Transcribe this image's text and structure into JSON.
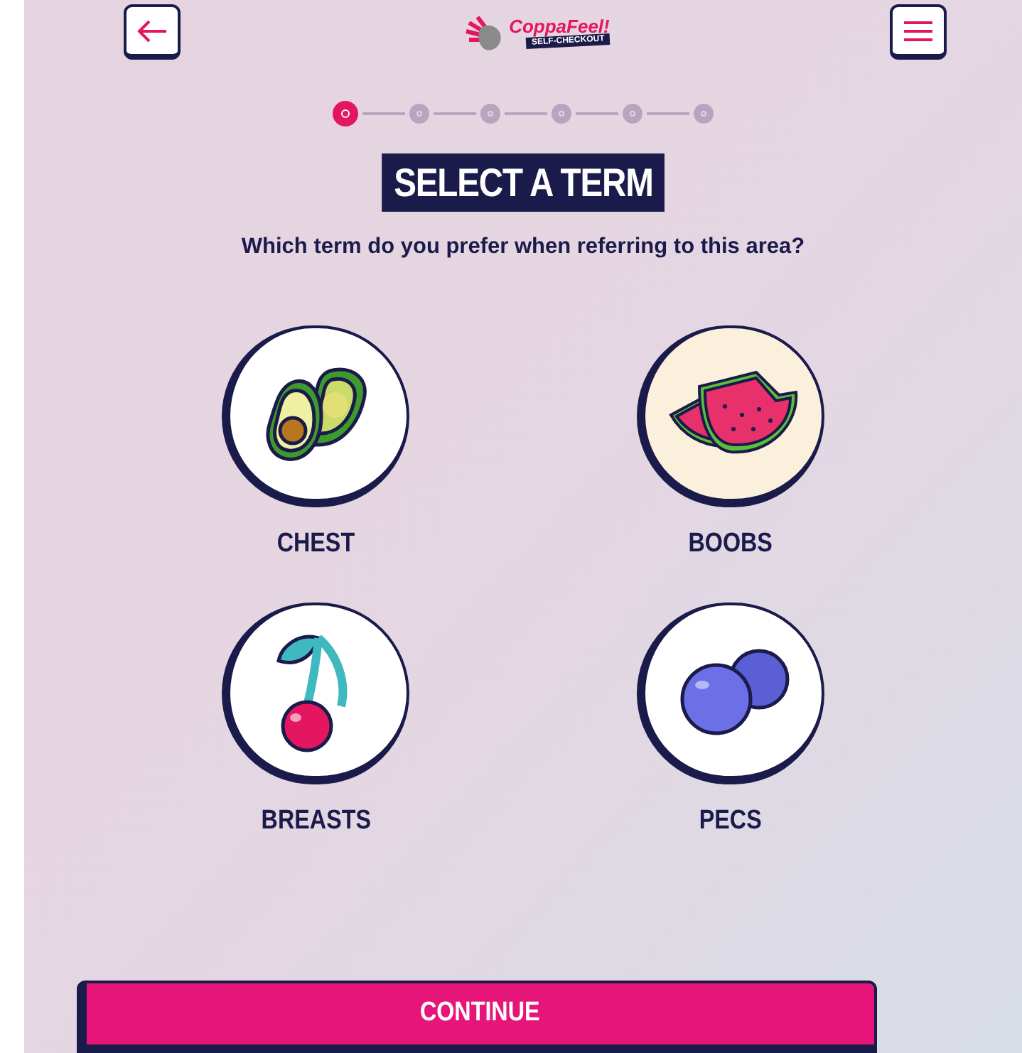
{
  "header": {
    "logo": {
      "title": "CoppaFeel!",
      "subtitle": "SELF-CHECKOUT"
    }
  },
  "steps": [
    {
      "selected": true
    },
    {
      "selected": false
    },
    {
      "selected": false
    },
    {
      "selected": false
    },
    {
      "selected": false
    },
    {
      "selected": false
    }
  ],
  "title": "SELECT A TERM",
  "question": "Which term do you prefer when referring to this area?",
  "options": [
    {
      "label": "CHEST",
      "kind": "avocado",
      "selected": false
    },
    {
      "label": "BOOBS",
      "kind": "watermelon",
      "selected": false
    },
    {
      "label": "BREASTS",
      "kind": "cherry",
      "selected": false
    },
    {
      "label": "PECS",
      "kind": "blueberry",
      "selected": false
    }
  ],
  "continue_button": "CONTINUE"
}
